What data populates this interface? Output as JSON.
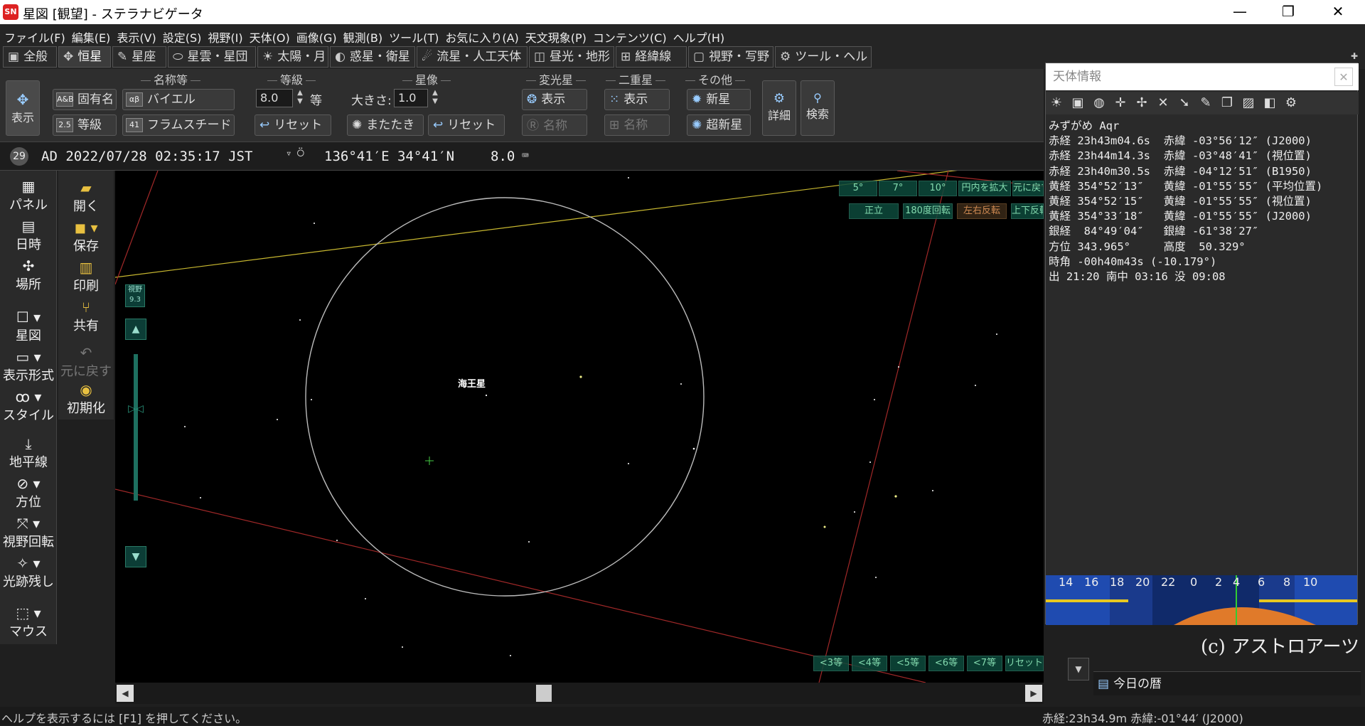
{
  "window": {
    "title": "星図 [観望] - ステラナビゲータ",
    "app_icon": "SN",
    "minimize": "—",
    "restore": "❐",
    "close": "✕"
  },
  "menu": [
    "ファイル(F)",
    "編集(E)",
    "表示(V)",
    "設定(S)",
    "視野(I)",
    "天体(O)",
    "画像(G)",
    "観測(B)",
    "ツール(T)",
    "お気に入り(A)",
    "天文現象(P)",
    "コンテンツ(C)",
    "ヘルプ(H)"
  ],
  "tabs": [
    {
      "label": "全般",
      "icon": "▣"
    },
    {
      "label": "恒星",
      "icon": "✥",
      "active": true
    },
    {
      "label": "星座",
      "icon": "✎"
    },
    {
      "label": "星雲・星団",
      "icon": "⬭"
    },
    {
      "label": "太陽・月",
      "icon": "☀"
    },
    {
      "label": "惑星・衛星",
      "icon": "◐"
    },
    {
      "label": "流星・人工天体",
      "icon": "☄"
    },
    {
      "label": "昼光・地形",
      "icon": "◫"
    },
    {
      "label": "経緯線",
      "icon": "⊞"
    },
    {
      "label": "視野・写野",
      "icon": "▢"
    },
    {
      "label": "ツール・ヘルプ",
      "icon": "⚙"
    }
  ],
  "ribbon": {
    "show_button": "表示",
    "groups": {
      "names": "名称等",
      "magnitude": "等級",
      "star_image": "星像",
      "variable": "変光星",
      "double": "二重星",
      "other": "その他"
    },
    "names_buttons": [
      "固有名",
      "バイエル",
      "等級",
      "フラムスチード"
    ],
    "names_icons": [
      "A&B",
      "αβ",
      "2.5",
      "41"
    ],
    "magnitude_value": "8.0",
    "magnitude_unit": "等",
    "reset": "リセット",
    "size_label": "大きさ:",
    "size_value": "1.0",
    "twinkle": "またたき",
    "variable_show": "表示",
    "variable_name": "名称",
    "double_show": "表示",
    "double_name": "名称",
    "nova": "新星",
    "supernova": "超新星",
    "detail": "詳細",
    "search": "検索"
  },
  "status_line": {
    "moon_age": "29",
    "datetime": "AD 2022/07/28 02:35:17 JST",
    "location": "136°41′E 34°41′N",
    "magnitude": "8.0"
  },
  "left_panel": [
    "パネル",
    "日時",
    "場所",
    "星図",
    "表示形式",
    "スタイル",
    "地平線",
    "方位",
    "視野回転",
    "光跡残し",
    "マウス"
  ],
  "left_panel2": [
    "開く",
    "保存",
    "印刷",
    "共有",
    "元に戻す",
    "初期化"
  ],
  "sky": {
    "object_label": "海王星",
    "fov_label": "視野",
    "fov_value": "9.3",
    "top_buttons": [
      "5°",
      "7°",
      "10°",
      "円内を拡大",
      "元に戻す"
    ],
    "top_buttons2": [
      "正立",
      "180度回転",
      "左右反転",
      "上下反転"
    ],
    "bottom_buttons": [
      "<3等",
      "<4等",
      "<5等",
      "<6等",
      "<7等",
      "リセット"
    ]
  },
  "info_panel": {
    "title": "天体情報",
    "lines": [
      "みずがめ Aqr",
      "赤経 23h43m04.6s  赤緯 -03°56′12″ (J2000)",
      "赤経 23h44m14.3s  赤緯 -03°48′41″ (視位置)",
      "赤経 23h40m30.5s  赤緯 -04°12′51″ (B1950)",
      "黄経 354°52′13″   黄緯 -01°55′55″ (平均位置)",
      "黄経 354°52′15″   黄緯 -01°55′55″ (視位置)",
      "黄経 354°33′18″   黄緯 -01°55′55″ (J2000)",
      "銀経  84°49′04″   銀緯 -61°38′27″",
      "方位 343.965°     高度  50.329°",
      "時角 -00h40m43s (-10.179°)",
      "出 21:20 南中 03:16 没 09:08"
    ],
    "timeline_hours": [
      "14",
      "16",
      "18",
      "20",
      "22",
      "0",
      "2",
      "4",
      "6",
      "8",
      "10"
    ]
  },
  "copyright": "(c) アストロアーツ",
  "calendar": "今日の暦",
  "statusbar": {
    "help": "ヘルプを表示するには [F1] を押してください。",
    "coords": "赤経:23h34.9m 赤緯:-01°44′ (J2000)"
  }
}
